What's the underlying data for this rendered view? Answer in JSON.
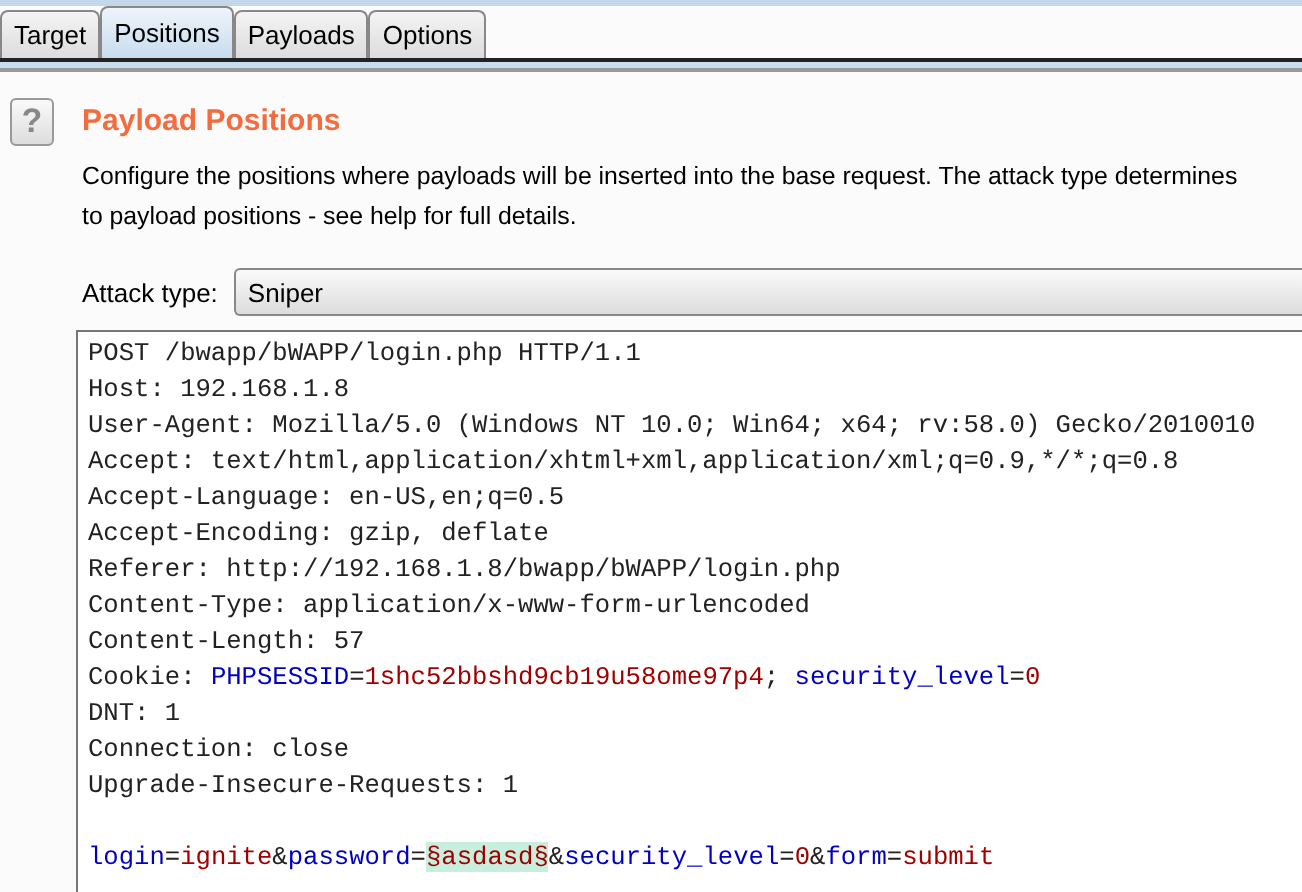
{
  "tabs": [
    {
      "label": "Target",
      "selected": false
    },
    {
      "label": "Positions",
      "selected": true
    },
    {
      "label": "Payloads",
      "selected": false
    },
    {
      "label": "Options",
      "selected": false
    }
  ],
  "section": {
    "help_icon": "?",
    "title": "Payload Positions",
    "description_lines": [
      "Configure the positions where payloads will be inserted into the base request. The attack type determines",
      "to payload positions - see help for full details."
    ]
  },
  "attack_type": {
    "label": "Attack type:",
    "value": "Sniper"
  },
  "request_lines": [
    [
      {
        "kind": "plain",
        "text": "POST /bwapp/bWAPP/login.php HTTP/1.1"
      }
    ],
    [
      {
        "kind": "plain",
        "text": "Host: 192.168.1.8"
      }
    ],
    [
      {
        "kind": "plain",
        "text": "User-Agent: Mozilla/5.0 (Windows NT 10.0; Win64; x64; rv:58.0) Gecko/2010010"
      }
    ],
    [
      {
        "kind": "plain",
        "text": "Accept: text/html,application/xhtml+xml,application/xml;q=0.9,*/*;q=0.8"
      }
    ],
    [
      {
        "kind": "plain",
        "text": "Accept-Language: en-US,en;q=0.5"
      }
    ],
    [
      {
        "kind": "plain",
        "text": "Accept-Encoding: gzip, deflate"
      }
    ],
    [
      {
        "kind": "plain",
        "text": "Referer: http://192.168.1.8/bwapp/bWAPP/login.php"
      }
    ],
    [
      {
        "kind": "plain",
        "text": "Content-Type: application/x-www-form-urlencoded"
      }
    ],
    [
      {
        "kind": "plain",
        "text": "Content-Length: 57"
      }
    ],
    [
      {
        "kind": "plain",
        "text": "Cookie: "
      },
      {
        "kind": "name",
        "text": "PHPSESSID"
      },
      {
        "kind": "plain",
        "text": "="
      },
      {
        "kind": "value",
        "text": "1shc52bbshd9cb19u58ome97p4"
      },
      {
        "kind": "plain",
        "text": "; "
      },
      {
        "kind": "name",
        "text": "security_level"
      },
      {
        "kind": "plain",
        "text": "="
      },
      {
        "kind": "value",
        "text": "0"
      }
    ],
    [
      {
        "kind": "plain",
        "text": "DNT: 1"
      }
    ],
    [
      {
        "kind": "plain",
        "text": "Connection: close"
      }
    ],
    [
      {
        "kind": "plain",
        "text": "Upgrade-Insecure-Requests: 1"
      }
    ],
    [
      {
        "kind": "blank"
      }
    ],
    [
      {
        "kind": "name",
        "text": "login"
      },
      {
        "kind": "plain",
        "text": "="
      },
      {
        "kind": "value",
        "text": "ignite"
      },
      {
        "kind": "plain",
        "text": "&"
      },
      {
        "kind": "name",
        "text": "password"
      },
      {
        "kind": "plain",
        "text": "="
      },
      {
        "kind": "marker",
        "text": "§asdasd§"
      },
      {
        "kind": "plain",
        "text": "&"
      },
      {
        "kind": "name",
        "text": "security_level"
      },
      {
        "kind": "plain",
        "text": "="
      },
      {
        "kind": "value",
        "text": "0"
      },
      {
        "kind": "plain",
        "text": "&"
      },
      {
        "kind": "name",
        "text": "form"
      },
      {
        "kind": "plain",
        "text": "="
      },
      {
        "kind": "value",
        "text": "submit"
      }
    ]
  ]
}
